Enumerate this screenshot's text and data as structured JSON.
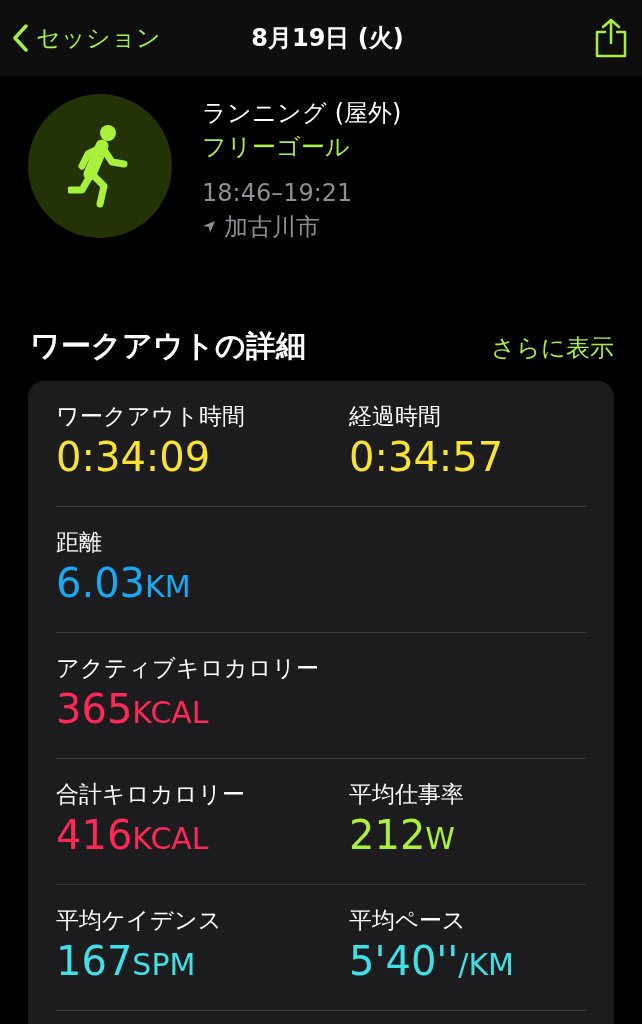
{
  "nav": {
    "back": "セッション",
    "title": "8月19日 (火)"
  },
  "workout": {
    "type": "ランニング (屋外)",
    "goal": "フリーゴール",
    "time": "18:46–19:21",
    "location": "加古川市"
  },
  "details": {
    "heading": "ワークアウトの詳細",
    "more": "さらに表示",
    "rows": [
      {
        "metrics": [
          {
            "label": "ワークアウト時間",
            "value": "0:34:09",
            "color": "#f8e42e"
          },
          {
            "label": "経過時間",
            "value": "0:34:57",
            "color": "#f8e42e"
          }
        ]
      },
      {
        "metrics": [
          {
            "label": "距離",
            "value": "6.03",
            "unit": "KM",
            "color": "#18a9f5"
          }
        ]
      },
      {
        "metrics": [
          {
            "label": "アクティブキロカロリー",
            "value": "365",
            "unit": "KCAL",
            "color": "#fc2857"
          }
        ]
      },
      {
        "metrics": [
          {
            "label": "合計キロカロリー",
            "value": "416",
            "unit": "KCAL",
            "color": "#fc2857"
          },
          {
            "label": "平均仕事率",
            "value": "212",
            "unit": "W",
            "color": "#aef038"
          }
        ]
      },
      {
        "metrics": [
          {
            "label": "平均ケイデンス",
            "value": "167",
            "unit": "SPM",
            "color": "#3fe0e6"
          },
          {
            "label": "平均ペース",
            "value": "5'40''",
            "unit": "/KM",
            "color": "#3fe0e6"
          }
        ]
      }
    ]
  }
}
